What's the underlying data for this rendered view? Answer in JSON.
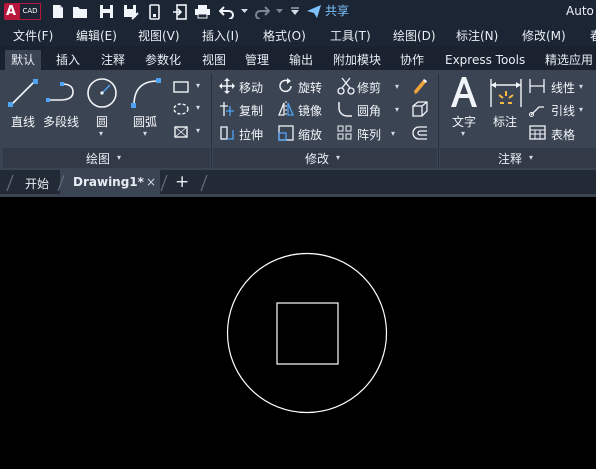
{
  "titlebar": {
    "logo_letter": "A",
    "logo_text": "CAD",
    "share_label": "共享",
    "app_title": "Auto"
  },
  "menubar": {
    "items": [
      "文件(F)",
      "编辑(E)",
      "视图(V)",
      "插入(I)",
      "格式(O)",
      "工具(T)",
      "绘图(D)",
      "标注(N)",
      "修改(M)",
      "春"
    ]
  },
  "ribbon_tabs": [
    "默认",
    "插入",
    "注释",
    "参数化",
    "视图",
    "管理",
    "输出",
    "附加模块",
    "协作",
    "Express Tools",
    "精选应用"
  ],
  "draw_panel": {
    "title": "绘图",
    "line": "直线",
    "polyline": "多段线",
    "circle": "圆",
    "arc": "圆弧"
  },
  "modify_panel": {
    "title": "修改",
    "move": "移动",
    "rotate": "旋转",
    "trim": "修剪",
    "copy": "复制",
    "mirror": "镜像",
    "fillet": "圆角",
    "stretch": "拉伸",
    "scale": "缩放",
    "array": "阵列"
  },
  "annotation_panel": {
    "title": "注释",
    "text": "文字",
    "dimension": "标注",
    "linear": "线性",
    "leader": "引线",
    "table": "表格"
  },
  "doc_tabs": {
    "start": "开始",
    "drawing": "Drawing1*",
    "close": "×",
    "new": "+"
  },
  "colors": {
    "titlebar": "#1c2533",
    "ribbon": "#3b4453",
    "accent": "#b8163b",
    "share": "#7ec3ff",
    "canvas": "#000000"
  }
}
